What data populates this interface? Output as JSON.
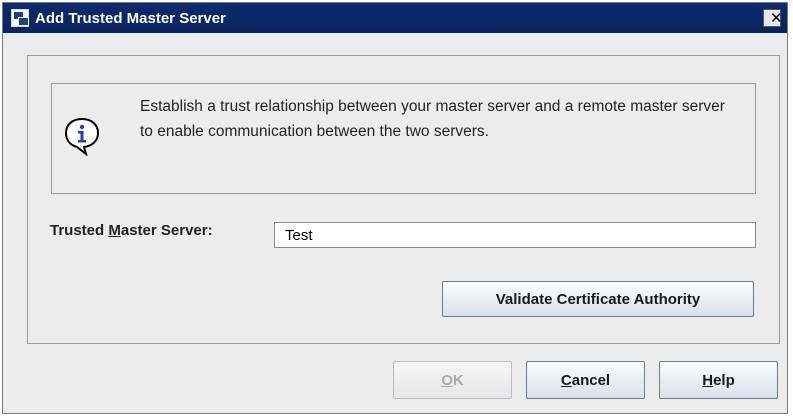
{
  "window": {
    "title": "Add Trusted Master Server",
    "close_label": "✕"
  },
  "info": {
    "icon": "info-speech-bubble-icon",
    "text": "Establish a trust relationship between your master server and a remote master server to enable communication between the two servers."
  },
  "form": {
    "label_prefix": "Trusted ",
    "label_mnemonic": "M",
    "label_suffix": "aster Server:",
    "server_value": "Test"
  },
  "buttons": {
    "validate_label": "Validate Certificate Authority",
    "ok_mnemonic": "O",
    "ok_rest": "K",
    "cancel_mnemonic": "C",
    "cancel_rest": "ancel",
    "help_mnemonic": "H",
    "help_rest": "elp"
  },
  "colors": {
    "titlebar": "#0b2460",
    "dialog_bg": "#ececec"
  }
}
